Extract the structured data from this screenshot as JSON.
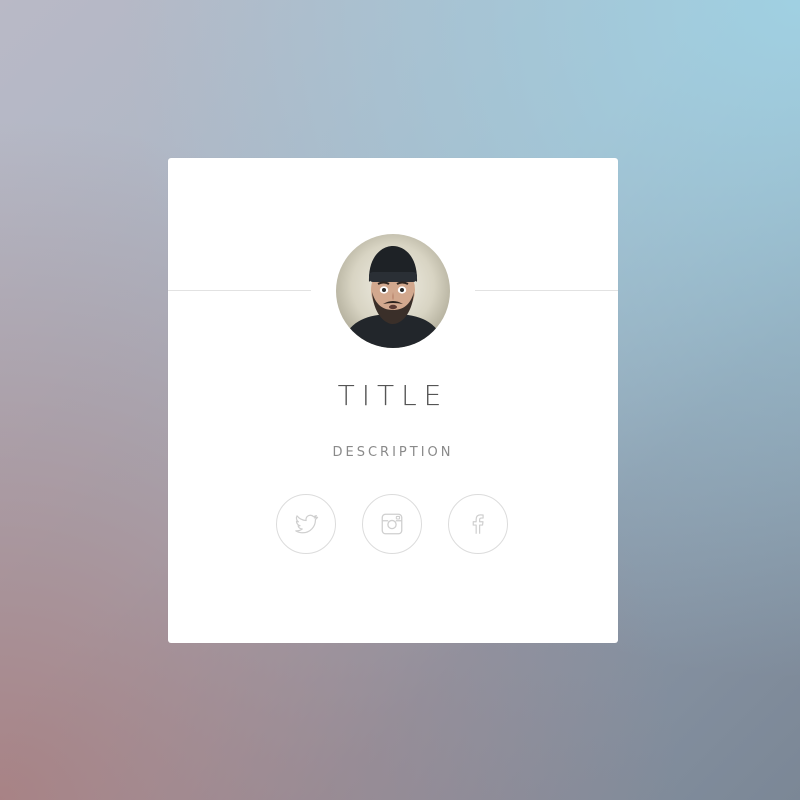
{
  "profile_card": {
    "title": "TITLE",
    "description": "DESCRIPTION",
    "avatar_alt": "profile photo",
    "social_links": [
      {
        "network": "twitter",
        "icon": "twitter-icon"
      },
      {
        "network": "instagram",
        "icon": "instagram-icon"
      },
      {
        "network": "facebook",
        "icon": "facebook-icon"
      }
    ]
  },
  "colors": {
    "card_background": "#ffffff",
    "title_text": "#555555",
    "description_text": "#8a8a8a",
    "icon_outline": "#cfcfcf"
  }
}
